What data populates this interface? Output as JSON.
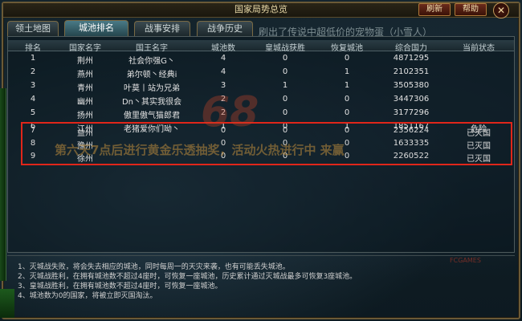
{
  "window": {
    "title": "国家局势总览",
    "refresh_label": "刷新",
    "help_label": "帮助",
    "close_glyph": "✕"
  },
  "tabs": [
    {
      "label": "领土地图",
      "active": false
    },
    {
      "label": "城池排名",
      "active": true
    },
    {
      "label": "战事安排",
      "active": false
    },
    {
      "label": "战争历史",
      "active": false
    }
  ],
  "marquee_text": "刷出了传说中超低价的宠物蛋（小雪人）",
  "table": {
    "headers": [
      "排名",
      "国家名字",
      "国王名字",
      "城池数",
      "皇城战获胜",
      "恢复城池",
      "综合国力",
      "当前状态"
    ],
    "rows": [
      {
        "rank": "1",
        "country": "荆州",
        "king": "社会你强G丶",
        "cities": "4",
        "wins": "0",
        "recover": "0",
        "power": "4871295",
        "status": ""
      },
      {
        "rank": "2",
        "country": "燕州",
        "king": "弟尔顿丶经典i",
        "cities": "4",
        "wins": "0",
        "recover": "1",
        "power": "2102351",
        "status": ""
      },
      {
        "rank": "3",
        "country": "青州",
        "king": "叶莫丨站为兄弟",
        "cities": "3",
        "wins": "1",
        "recover": "1",
        "power": "3505380",
        "status": ""
      },
      {
        "rank": "4",
        "country": "幽州",
        "king": "Dn丶其实我很会",
        "cities": "2",
        "wins": "0",
        "recover": "0",
        "power": "3447306",
        "status": ""
      },
      {
        "rank": "5",
        "country": "扬州",
        "king": "傲里傲气猫郎君",
        "cities": "2",
        "wins": "0",
        "recover": "0",
        "power": "3177296",
        "status": ""
      },
      {
        "rank": "6",
        "country": "江州",
        "king": "老猪爱你们呦丶",
        "cities": "1",
        "wins": "0",
        "recover": "1",
        "power": "1851167",
        "status": "危险"
      },
      {
        "rank": "7",
        "country": "益州",
        "king": "",
        "cities": "0",
        "wins": "0",
        "recover": "0",
        "power": "2356224",
        "status": "已灭国"
      },
      {
        "rank": "8",
        "country": "豫州",
        "king": "",
        "cities": "0",
        "wins": "0",
        "recover": "0",
        "power": "1633335",
        "status": "已灭国"
      },
      {
        "rank": "9",
        "country": "徐州",
        "king": "",
        "cities": "0",
        "wins": "0",
        "recover": "0",
        "power": "2260522",
        "status": "已灭国"
      }
    ]
  },
  "watermarks": {
    "promo": "第六天7点后进行黄金乐透抽奖，活动火热进行中  来赢",
    "logo": "68",
    "corner": "FCGAMES"
  },
  "notes": [
    "1、灭城战失败，将会失去相应的城池，同时每周一的天灾来袭，也有可能丢失城池。",
    "2、灭城战胜利，在拥有城池数不超过4座时，可恢复一座城池，历史累计通过灭城战最多可恢复3座城池。",
    "3、皇城战胜利，在拥有城池数不超过4座时，可恢复一座城池。",
    "4、城池数为0的国家，将被立即灭国淘汰。"
  ],
  "colors": {
    "frame": "#6b5a36",
    "highlight": "#e0261a",
    "active_tab": "#4a7a86"
  }
}
